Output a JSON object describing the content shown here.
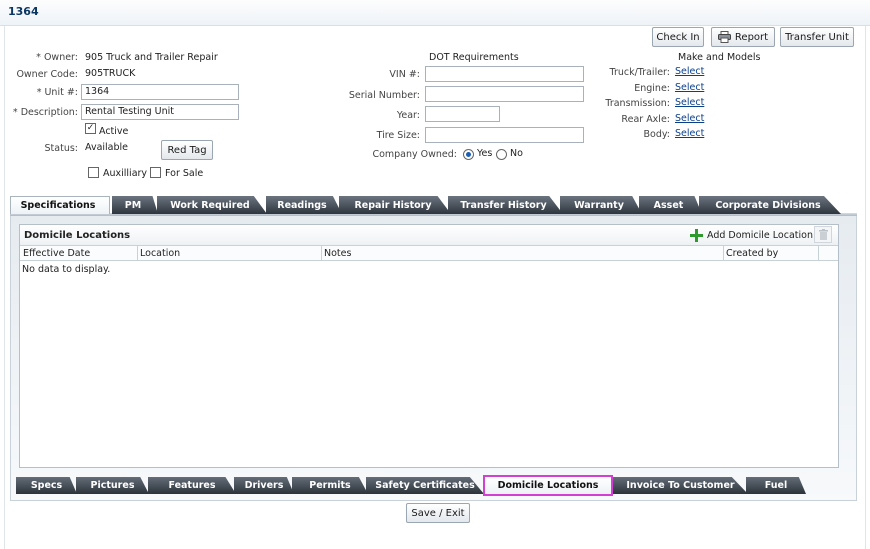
{
  "window": {
    "title": "1364"
  },
  "toolbar": {
    "check_in": "Check In",
    "report": "Report",
    "transfer_unit": "Transfer Unit"
  },
  "owner_section": {
    "owner_label": "* Owner:",
    "owner_value": "905 Truck and Trailer Repair",
    "owner_code_label": "Owner Code:",
    "owner_code_value": "905TRUCK",
    "unit_label": "* Unit #:",
    "unit_value": "1364",
    "description_label": "* Description:",
    "description_value": "Rental Testing Unit",
    "active_label": "Active",
    "active_checked": true,
    "status_label": "Status:",
    "status_value": "Available",
    "red_tag_button": "Red Tag",
    "auxilliary_label": "Auxilliary",
    "for_sale_label": "For Sale"
  },
  "dot_section": {
    "heading": "DOT Requirements",
    "vin_label": "VIN #:",
    "serial_label": "Serial Number:",
    "year_label": "Year:",
    "tire_size_label": "Tire Size:",
    "company_owned_label": "Company Owned:",
    "yes_label": "Yes",
    "no_label": "No",
    "company_owned_value": "Yes"
  },
  "make_section": {
    "heading": "Make and Models",
    "rows": [
      {
        "label": "Truck/Trailer:",
        "link": "Select"
      },
      {
        "label": "Engine:",
        "link": "Select"
      },
      {
        "label": "Transmission:",
        "link": "Select"
      },
      {
        "label": "Rear Axle:",
        "link": "Select"
      },
      {
        "label": "Body:",
        "link": "Select"
      }
    ]
  },
  "top_tabs": [
    "Specifications",
    "PM",
    "Work Required",
    "Readings",
    "Repair History",
    "Transfer History",
    "Warranty",
    "Asset",
    "Corporate Divisions"
  ],
  "panel": {
    "title": "Domicile Locations",
    "add_button": "Add Domicile Location",
    "columns": [
      "Effective Date",
      "Location",
      "Notes",
      "Created by"
    ],
    "empty_message": "No data to display."
  },
  "bottom_tabs": [
    "Specs",
    "Pictures",
    "Features",
    "Drivers",
    "Permits",
    "Safety Certificates",
    "Domicile Locations",
    "Invoice To Customer",
    "Fuel"
  ],
  "footer": {
    "save_exit": "Save / Exit"
  },
  "colors": {
    "accent": "#0b3763",
    "highlight": "#d23fd2",
    "add_icon": "#2e9a2e"
  }
}
